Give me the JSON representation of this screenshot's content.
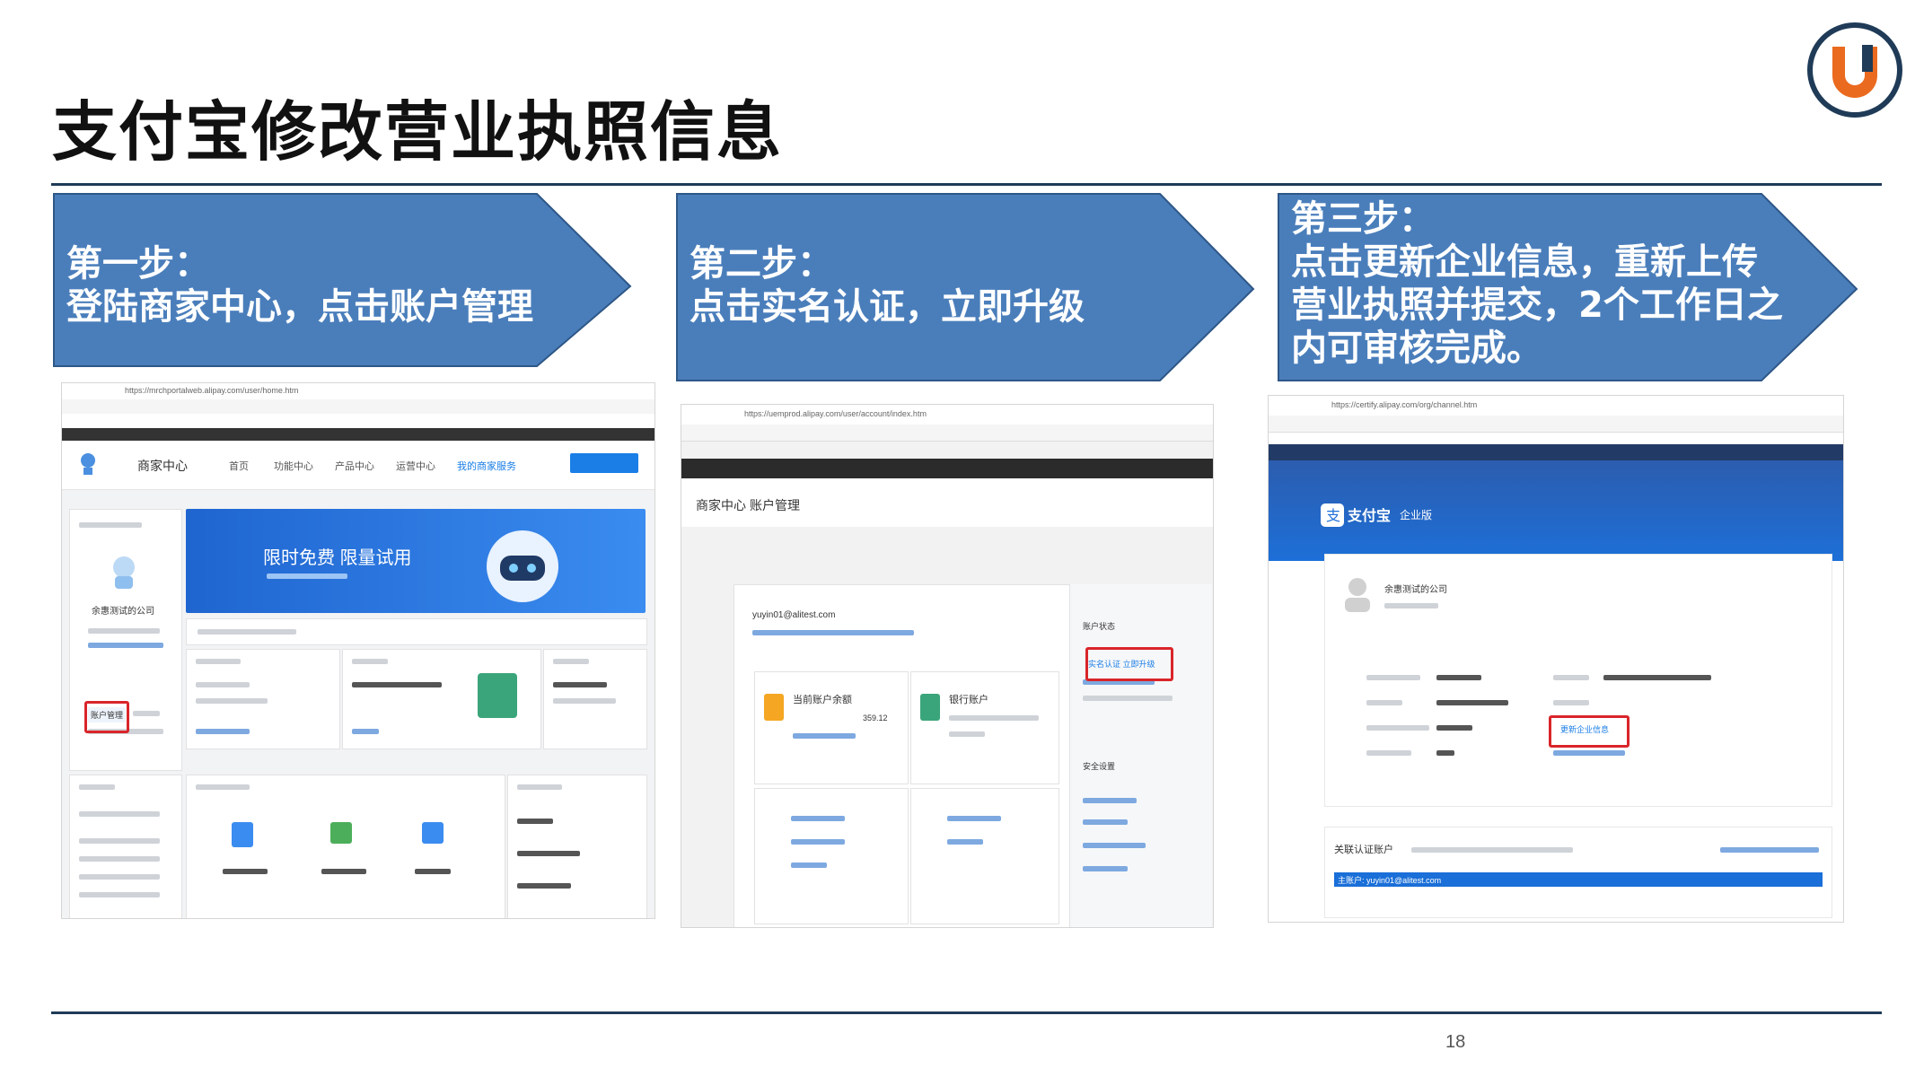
{
  "page": {
    "title": "支付宝修改营业执照信息",
    "page_number": "18"
  },
  "steps": [
    {
      "heading": "第一步：",
      "body": "登陆商家中心，点击账户管理"
    },
    {
      "heading": "第二步：",
      "body": "点击实名认证，立即升级"
    },
    {
      "heading": "第三步：",
      "body_lines": [
        "点击更新企业信息，重新上传",
        "营业执照并提交，2个工作日之",
        "内可审核完成。"
      ]
    }
  ],
  "screenshots": {
    "shot1": {
      "url": "https://mrchportalweb.alipay.com/user/home.htm",
      "brand": "商家中心",
      "nav": [
        "首页",
        "功能中心",
        "产品中心",
        "运营中心",
        "我的商家服务"
      ],
      "banner": "限时免费 限量试用",
      "company": "余惠测试的公司",
      "account_button": "账户管理"
    },
    "shot2": {
      "url": "https://uemprod.alipay.com/user/account/index.htm",
      "brand": "商家中心",
      "section": "账户管理",
      "email": "yuyin01@alitest.com",
      "card1_title": "当前账户余额",
      "card1_value": "359.12",
      "card2_title": "银行账户",
      "side_title": "账户状态",
      "side_link": "实名认证  立即升级",
      "side_security": "安全设置"
    },
    "shot3": {
      "url": "https://certify.alipay.com/org/channel.htm",
      "brand": "支付宝",
      "brand_sub": "企业版",
      "company": "余惠测试的公司",
      "update_link": "更新企业信息",
      "linked_title": "关联认证账户",
      "linked_row": "主账户: yuyin01@alitest.com"
    }
  },
  "colors": {
    "arrow_fill": "#4a7ebb",
    "arrow_stroke": "#2e5787",
    "rule": "#1f3b57",
    "highlight": "#d9252a",
    "logo_ring": "#1f3b57",
    "logo_u": "#ea6a1f"
  }
}
